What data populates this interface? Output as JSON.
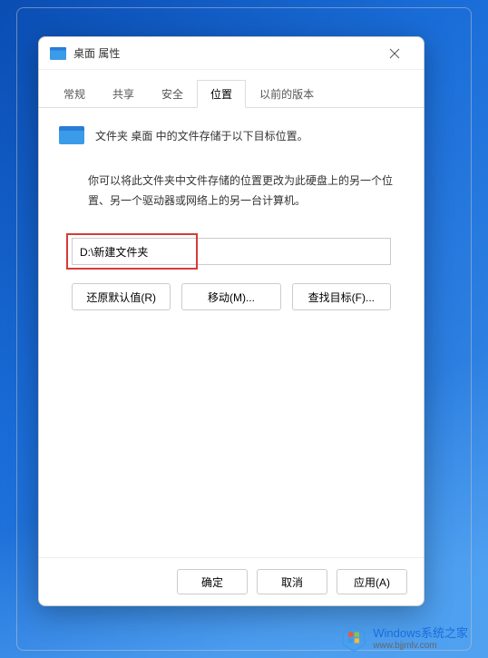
{
  "dialog": {
    "title": "桌面 属性",
    "tabs": {
      "general": "常规",
      "sharing": "共享",
      "security": "安全",
      "location": "位置",
      "previous": "以前的版本"
    },
    "folder_line": "文件夹 桌面 中的文件存储于以下目标位置。",
    "description": "你可以将此文件夹中文件存储的位置更改为此硬盘上的另一个位置、另一个驱动器或网络上的另一台计算机。",
    "path_value": "D:\\新建文件夹",
    "buttons": {
      "restore": "还原默认值(R)",
      "move": "移动(M)...",
      "find": "查找目标(F)..."
    },
    "footer": {
      "ok": "确定",
      "cancel": "取消",
      "apply": "应用(A)"
    }
  },
  "watermark": {
    "brand": "Windows系统之家",
    "url": "www.bjjmlv.com"
  }
}
